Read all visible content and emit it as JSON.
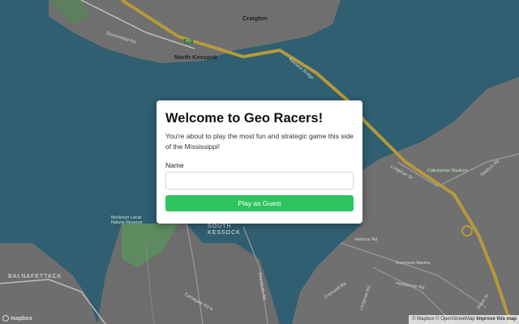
{
  "map": {
    "labels": {
      "craigton": "Craigton",
      "north_kessock": "North Kessock",
      "south_kessock": "SOUTH\nKESSOCK",
      "balnafettack": "BALNAFETTACK",
      "drumsmittal_rd": "Drumsmittal Rd",
      "kessock_bridge": "Kessock Bridge",
      "longman_dr": "Longman Dr",
      "stadium_rd": "Stadium Rd",
      "caledonian_stadium": "Caledonian Stadium",
      "harbour_rd": "Harbour Rd",
      "carsegate_rd_n": "Carsegate Rd N",
      "thornbush_rd": "Thornbush Rd",
      "merkinch_reserve": "Merkinch Local Nature Reserve",
      "inverness_marina": "Inverness Marina",
      "henderson_rd": "Henderson Rd",
      "cromwell_rd": "Cromwell Rd",
      "longman_rd": "Longman Rd",
      "shore_st": "Shore St",
      "a9": "A9"
    },
    "attribution": {
      "mapbox": "© Mapbox",
      "osm": "© OpenStreetMap",
      "improve": "Improve this map"
    },
    "logo": "mapbox"
  },
  "modal": {
    "title": "Welcome to Geo Racers!",
    "description": "You're about to play the most fun and strategic game this side of the Mississippi!",
    "name_label": "Name",
    "name_value": "",
    "name_placeholder": "",
    "play_button": "Play as Guest"
  },
  "colors": {
    "water": "#2f5f70",
    "land": "#707070",
    "park": "#5b8a5e",
    "road_major": "#b59a3c",
    "button": "#2ec45e"
  }
}
